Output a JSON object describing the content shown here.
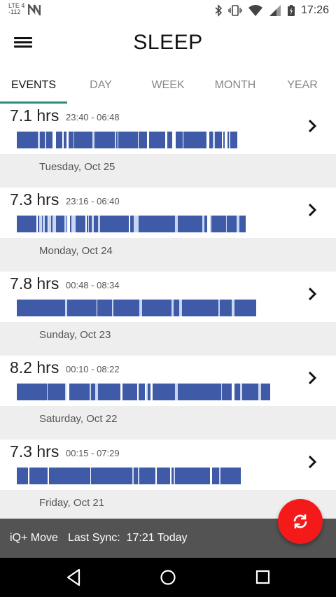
{
  "statusbar": {
    "network": "LTE 4",
    "signal_dbm": "-112",
    "time": "17:26"
  },
  "app": {
    "title": "SLEEP"
  },
  "tabs": [
    {
      "label": "EVENTS",
      "active": true
    },
    {
      "label": "DAY",
      "active": false
    },
    {
      "label": "WEEK",
      "active": false
    },
    {
      "label": "MONTH",
      "active": false
    },
    {
      "label": "YEAR",
      "active": false
    }
  ],
  "events": [
    {
      "hours": "7.1 hrs",
      "range": "23:40 - 06:48",
      "date_after": "Tuesday, Oct 25"
    },
    {
      "hours": "7.3 hrs",
      "range": "23:16 - 06:40",
      "date_after": "Monday, Oct 24"
    },
    {
      "hours": "7.8 hrs",
      "range": "00:48 - 08:34",
      "date_after": "Sunday, Oct 23"
    },
    {
      "hours": "8.2 hrs",
      "range": "00:10 - 08:22",
      "date_after": "Saturday, Oct 22"
    },
    {
      "hours": "7.3 hrs",
      "range": "00:15 - 07:29",
      "date_after": "Friday, Oct 21"
    }
  ],
  "footer": {
    "device": "iQ+ Move",
    "sync_label": "Last Sync:",
    "sync_time": "17:21 Today"
  },
  "colors": {
    "sleep_bar": "#3f5aa6",
    "accent": "#2a8d7e",
    "fab": "#f51a1a",
    "footer": "#535353"
  },
  "icons": {
    "menu": "menu-icon",
    "chevron": "chevron-right-icon",
    "sync": "sync-icon"
  }
}
